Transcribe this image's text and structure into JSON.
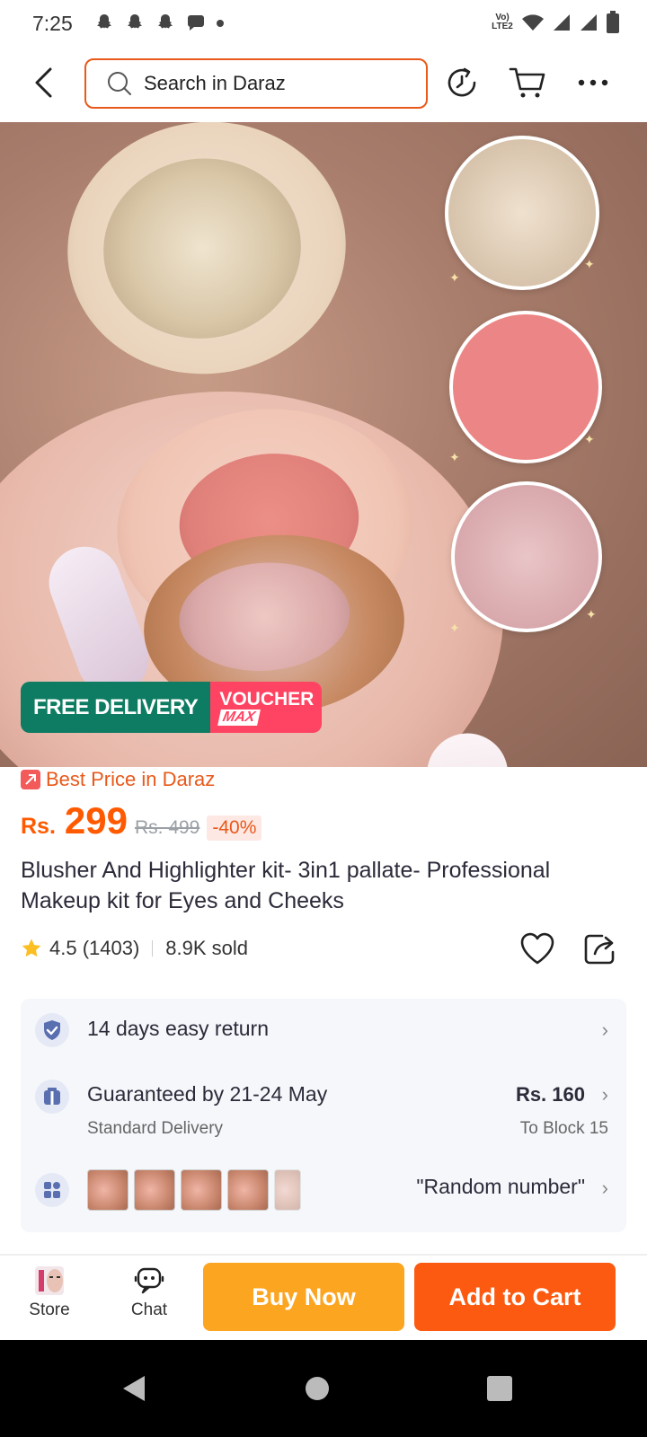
{
  "status_bar": {
    "time": "7:25",
    "network_label": "Vo) LTE2",
    "icons": [
      "snapchat-icon",
      "snapchat-icon",
      "snapchat-icon",
      "chat-bubble-icon",
      "dot-icon",
      "wifi-icon",
      "signal-icon",
      "signal-icon",
      "battery-icon"
    ]
  },
  "header": {
    "search_placeholder": "Search in Daraz",
    "icons": [
      "back-arrow-icon",
      "search-icon",
      "history-icon",
      "cart-icon",
      "more-icon"
    ]
  },
  "hero": {
    "badge_free_delivery": "FREE DELIVERY",
    "badge_voucher": "VOUCHER",
    "badge_voucher_max": "MAX"
  },
  "product": {
    "best_price_label": "Best Price in Daraz",
    "currency": "Rs.",
    "price": "299",
    "original_price": "Rs. 499",
    "discount": "-40%",
    "title": "Blusher And Highlighter kit- 3in1 pallate- Professional Makeup kit for Eyes and Cheeks",
    "rating": "4.5 (1403)",
    "sold": "8.9K sold"
  },
  "services": {
    "return_label": "14 days easy return",
    "delivery_label": "Guaranteed by 21-24 May",
    "delivery_type": "Standard Delivery",
    "delivery_price": "Rs. 160",
    "delivery_destination": "To Block 15",
    "variant_label": "\"Random number\""
  },
  "bottom_bar": {
    "store_label": "Store",
    "chat_label": "Chat",
    "buy_now_label": "Buy Now",
    "add_to_cart_label": "Add to Cart"
  },
  "colors": {
    "accent": "#fc5a10",
    "buy_now": "#fca521",
    "free_delivery": "#0e7c62",
    "voucher": "#ff4463",
    "search_border": "#e8591a"
  }
}
